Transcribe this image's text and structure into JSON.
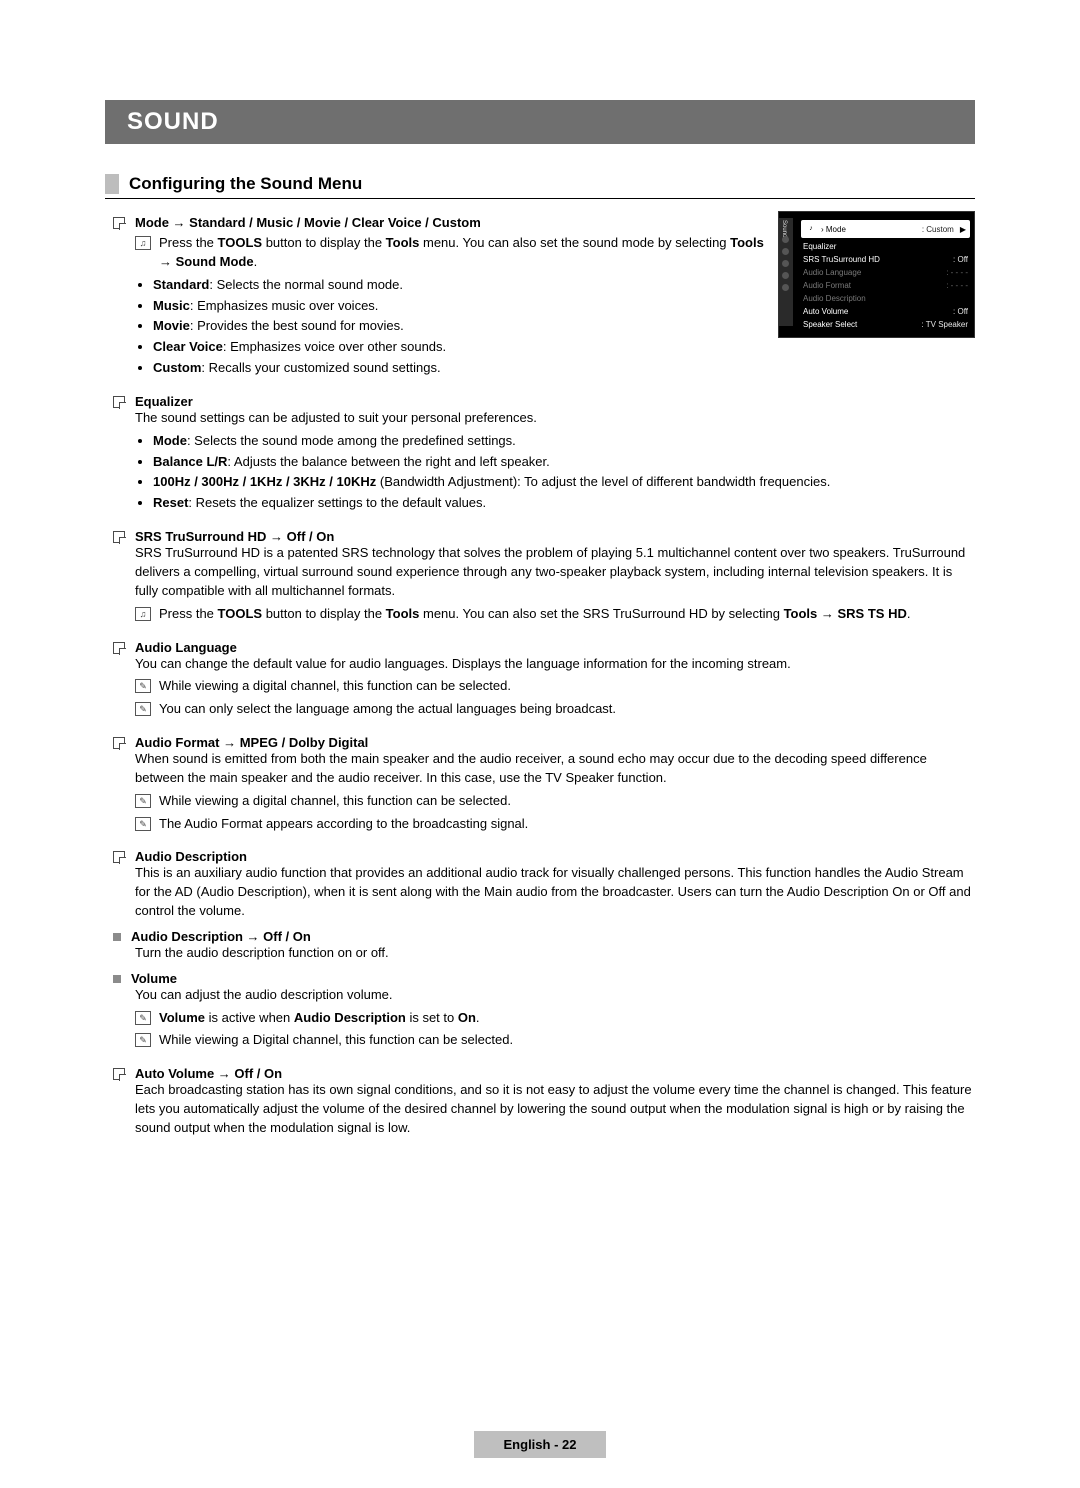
{
  "chapter": "SOUND",
  "section": "Configuring the Sound Menu",
  "tv": {
    "sidebar_label": "Sound",
    "rows": [
      {
        "label": "Mode",
        "value": ": Custom",
        "selected": true,
        "arrow": "▶",
        "dim": false
      },
      {
        "label": "Equalizer",
        "value": "",
        "dim": false
      },
      {
        "label": "SRS TruSurround HD",
        "value": ": Off",
        "dim": false
      },
      {
        "label": "Audio Language",
        "value": ": - - - -",
        "dim": true
      },
      {
        "label": "Audio Format",
        "value": ": - - - -",
        "dim": true
      },
      {
        "label": "Audio Description",
        "value": "",
        "dim": true
      },
      {
        "label": "Auto Volume",
        "value": ": Off",
        "dim": false
      },
      {
        "label": "Speaker Select",
        "value": ": TV Speaker",
        "dim": false
      }
    ]
  },
  "mode": {
    "title": "Mode → Standard / Music / Movie / Clear Voice / Custom",
    "tool_pre": "Press the ",
    "tool_b1": "TOOLS",
    "tool_mid": " button to display the ",
    "tool_b2": "Tools",
    "tool_post": " menu. You can also set the sound mode by selecting ",
    "tool_b3": "Tools → Sound Mode",
    "tool_end": ".",
    "items": [
      {
        "b": "Standard",
        "t": ": Selects the normal sound mode."
      },
      {
        "b": "Music",
        "t": ": Emphasizes music over voices."
      },
      {
        "b": "Movie",
        "t": ": Provides the best sound for movies."
      },
      {
        "b": "Clear Voice",
        "t": ": Emphasizes voice over other sounds."
      },
      {
        "b": "Custom",
        "t": ": Recalls your customized sound settings."
      }
    ]
  },
  "eq": {
    "title": "Equalizer",
    "intro": "The sound settings can be adjusted to suit your personal preferences.",
    "items": [
      {
        "b": "Mode",
        "t": ": Selects the sound mode among the predefined settings."
      },
      {
        "b": "Balance L/R",
        "t": ": Adjusts the balance between the right and left speaker."
      },
      {
        "b": "100Hz / 300Hz / 1KHz / 3KHz / 10KHz",
        "t": " (Bandwidth Adjustment): To adjust the level of different bandwidth frequencies."
      },
      {
        "b": "Reset",
        "t": ": Resets the equalizer settings to the default values."
      }
    ]
  },
  "srs": {
    "title": "SRS TruSurround HD → Off / On",
    "body": "SRS TruSurround HD is a patented SRS technology that solves the problem of playing 5.1 multichannel content over two speakers. TruSurround delivers a compelling, virtual surround sound experience through any two-speaker playback system, including internal television speakers. It is fully compatible with all multichannel formats.",
    "tool_pre": "Press the ",
    "tool_b1": "TOOLS",
    "tool_mid": " button to display the ",
    "tool_b2": "Tools",
    "tool_post": " menu. You can also set the SRS TruSurround HD by selecting ",
    "tool_b3": "Tools → SRS TS HD",
    "tool_end": "."
  },
  "alang": {
    "title": "Audio Language",
    "body": "You can change the default value for audio languages. Displays the language information for the incoming stream.",
    "n1": "While viewing a digital channel, this function can be selected.",
    "n2": "You can only select the language among the actual languages being broadcast."
  },
  "afmt": {
    "title": "Audio Format → MPEG / Dolby Digital",
    "body": "When sound is emitted from both the main speaker and the audio receiver, a sound echo may occur due to the decoding speed difference between the main speaker and the audio receiver. In this case, use the TV Speaker function.",
    "n1": "While viewing a digital channel, this function can be selected.",
    "n2": "The Audio Format appears according to the broadcasting signal."
  },
  "adesc": {
    "title": "Audio Description",
    "body": "This is an auxiliary audio function that provides an additional audio track for visually challenged persons. This function handles the Audio Stream for the AD (Audio Description), when it is sent along with the Main audio from the broadcaster. Users can turn the Audio Description On or Off and control the volume.",
    "sub1_title": "Audio Description → Off / On",
    "sub1_body": "Turn the audio description function on or off.",
    "sub2_title": "Volume",
    "sub2_body": "You can adjust the audio description volume.",
    "sub2_n1_b1": "Volume",
    "sub2_n1_mid": " is active when ",
    "sub2_n1_b2": "Audio Description",
    "sub2_n1_post": " is set to ",
    "sub2_n1_b3": "On",
    "sub2_n1_end": ".",
    "sub2_n2": "While viewing a Digital channel, this function can be selected."
  },
  "avol": {
    "title": "Auto Volume → Off / On",
    "body": "Each broadcasting station has its own signal conditions, and so it is not easy to adjust the volume every time the channel is changed. This feature lets you automatically adjust the volume of the desired channel by lowering the sound output when the modulation signal is high or by raising the sound output when the modulation signal is low."
  },
  "footer": {
    "lang": "English - ",
    "page": "22"
  }
}
